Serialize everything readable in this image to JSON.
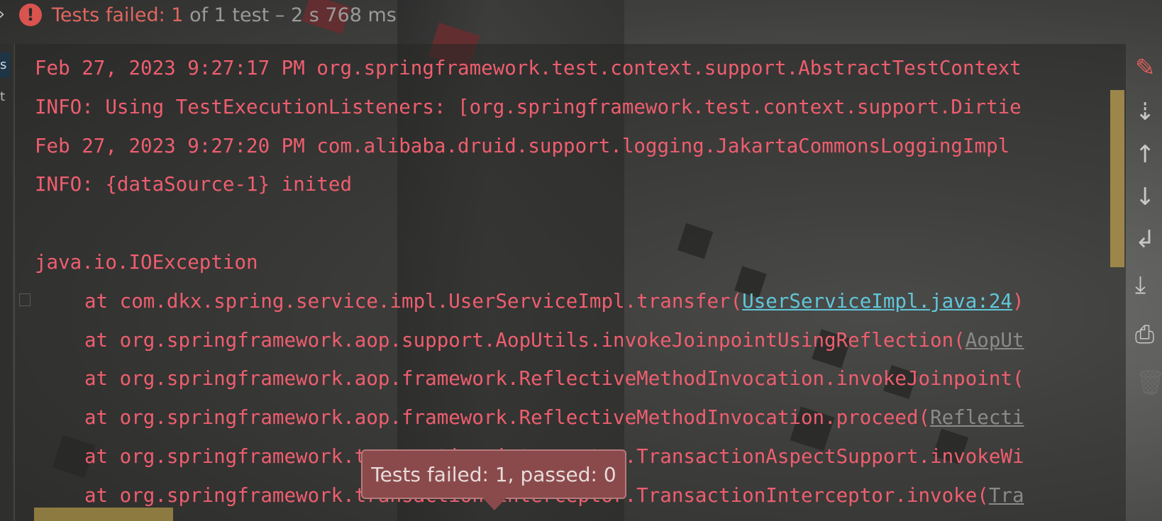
{
  "topbar": {
    "status_failed": "Tests failed: 1",
    "status_rest": " of 1 test – 2 s 768 ms"
  },
  "gutter": {
    "s": "s",
    "t": "t"
  },
  "console": {
    "lines": [
      {
        "text": "Feb 27, 2023 9:27:17 PM org.springframework.test.context.support.AbstractTestContext"
      },
      {
        "text": "INFO: Using TestExecutionListeners: [org.springframework.test.context.support.Dirtie"
      },
      {
        "text": "Feb 27, 2023 9:27:20 PM com.alibaba.druid.support.logging.JakartaCommonsLoggingImpl"
      },
      {
        "text": "INFO: {dataSource-1} inited"
      },
      {
        "text": ""
      },
      {
        "text": "java.io.IOException"
      }
    ],
    "stack": [
      {
        "prefix": "at com.dkx.spring.service.impl.UserServiceImpl.transfer(",
        "link": "UserServiceImpl.java:24",
        "suffix": ")"
      },
      {
        "prefix": "at org.springframework.aop.support.AopUtils.invokeJoinpointUsingReflection(",
        "link": "AopUt",
        "suffix": ""
      },
      {
        "prefix": "at org.springframework.aop.framework.ReflectiveMethodInvocation.invokeJoinpoint(",
        "link": "",
        "suffix": ""
      },
      {
        "prefix": "at org.springframework.aop.framework.ReflectiveMethodInvocation.proceed(",
        "link": "Reflecti",
        "suffix": ""
      },
      {
        "prefix": "at org.springframework.transaction.interceptor.TransactionAspectSupport.invokeWi",
        "link": "",
        "suffix": ""
      },
      {
        "prefix": "at org.springframework.transaction.interceptor.TransactionInterceptor.invoke(",
        "link": "Tra",
        "suffix": ""
      }
    ]
  },
  "tooltip": {
    "text": "Tests failed: 1, passed: 0"
  },
  "toolbar": {
    "icons": [
      "clear-all-icon",
      "scroll-to-end-icon",
      "up-arrow-icon",
      "down-arrow-icon",
      "soft-wrap-icon",
      "scroll-to-end-icon",
      "print-icon",
      "trash-icon"
    ]
  },
  "colors": {
    "error": "#ee5e6e",
    "link": "#61c6d9",
    "tooltip_bg": "#8a4a4b"
  }
}
